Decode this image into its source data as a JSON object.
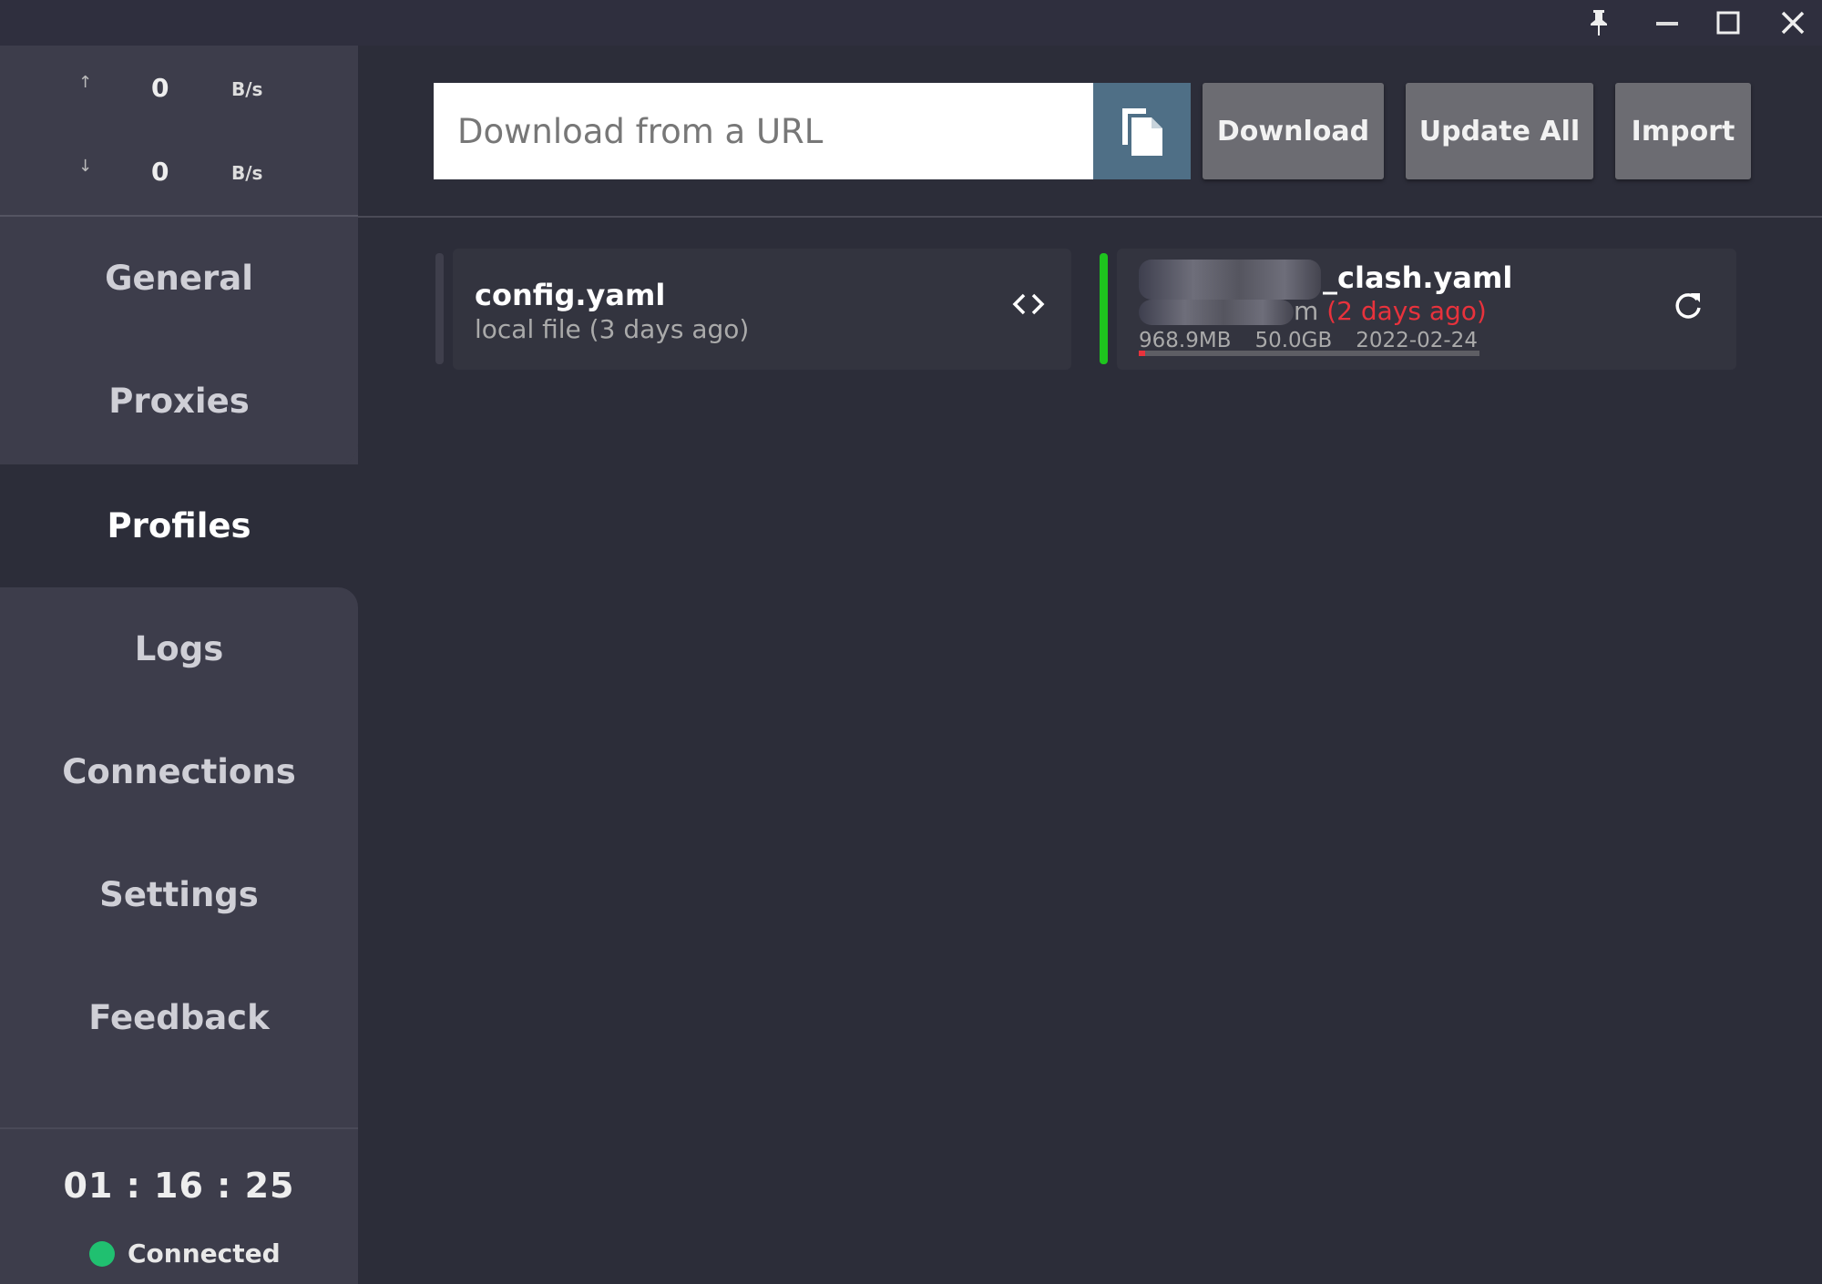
{
  "window_controls": {
    "pin": "pin-icon",
    "minimize": "minimize-icon",
    "maximize": "maximize-icon",
    "close": "close-icon"
  },
  "speed": {
    "up_arrow": "↑",
    "up_value": "0",
    "up_unit": "B/s",
    "down_arrow": "↓",
    "down_value": "0",
    "down_unit": "B/s"
  },
  "nav": {
    "items": [
      {
        "label": "General"
      },
      {
        "label": "Proxies"
      },
      {
        "label": "Profiles"
      },
      {
        "label": "Logs"
      },
      {
        "label": "Connections"
      },
      {
        "label": "Settings"
      },
      {
        "label": "Feedback"
      }
    ],
    "active": "Profiles"
  },
  "footer": {
    "timer": "01 : 16 : 25",
    "status": "Connected",
    "status_color": "#20c070"
  },
  "toolbar": {
    "url_placeholder": "Download from a URL",
    "download": "Download",
    "update_all": "Update All",
    "import": "Import"
  },
  "profiles": [
    {
      "name": "config.yaml",
      "subtitle": "local file (3 days ago)",
      "selected": false,
      "action_icon": "code-icon"
    },
    {
      "name": "_clash.yaml",
      "subtitle_visible": "m",
      "updated": "(2 days ago)",
      "used": "968.9MB",
      "total": "50.0GB",
      "expire": "2022-02-24",
      "usage_percent": 2,
      "selected": true,
      "action_icon": "refresh-icon"
    }
  ],
  "colors": {
    "accent_selected": "#1ec41e",
    "warning": "#e8323c",
    "copy_button": "#4f6f86"
  }
}
